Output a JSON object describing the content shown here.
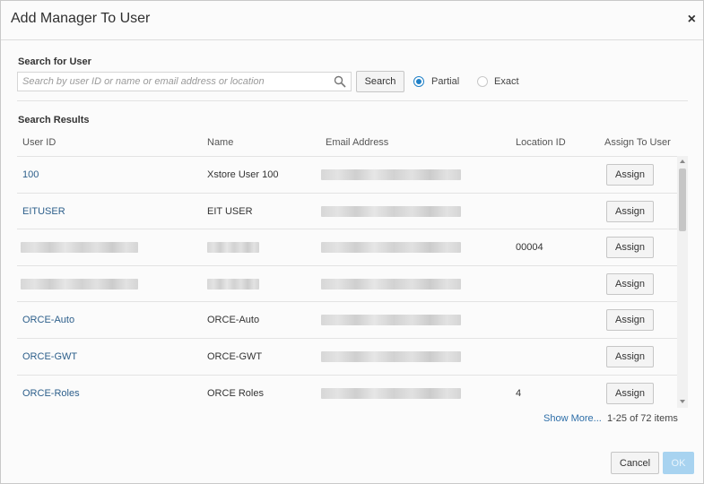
{
  "dialog": {
    "title": "Add Manager To User",
    "close_icon": "×"
  },
  "search": {
    "heading": "Search for User",
    "placeholder": "Search by user ID or name or email address or location",
    "value": "",
    "button_label": "Search",
    "modes": [
      {
        "label": "Partial",
        "selected": true
      },
      {
        "label": "Exact",
        "selected": false
      }
    ]
  },
  "results": {
    "heading": "Search Results",
    "columns": [
      "User ID",
      "Name",
      "Email Address",
      "Location ID",
      "Assign To User"
    ],
    "rows": [
      {
        "user_id": "100",
        "name": "Xstore User 100",
        "location_id": "",
        "action": "Assign",
        "user_id_redacted": false,
        "name_redacted": false
      },
      {
        "user_id": "EITUSER",
        "name": "EIT USER",
        "location_id": "",
        "action": "Assign",
        "user_id_redacted": false,
        "name_redacted": false
      },
      {
        "user_id": "",
        "name": "",
        "location_id": "00004",
        "action": "Assign",
        "user_id_redacted": true,
        "name_redacted": true
      },
      {
        "user_id": "",
        "name": "",
        "location_id": "",
        "action": "Assign",
        "user_id_redacted": true,
        "name_redacted": true
      },
      {
        "user_id": "ORCE-Auto",
        "name": "ORCE-Auto",
        "location_id": "",
        "action": "Assign",
        "user_id_redacted": false,
        "name_redacted": false
      },
      {
        "user_id": "ORCE-GWT",
        "name": "ORCE-GWT",
        "location_id": "",
        "action": "Assign",
        "user_id_redacted": false,
        "name_redacted": false
      },
      {
        "user_id": "ORCE-Roles",
        "name": "ORCE Roles",
        "location_id": "4",
        "action": "Assign",
        "user_id_redacted": false,
        "name_redacted": false
      }
    ],
    "show_more": "Show More...",
    "count": "1-25 of 72 items"
  },
  "footer": {
    "cancel_label": "Cancel",
    "ok_label": "OK"
  },
  "colors": {
    "accent": "#1f80c7",
    "link": "#2d6ea8",
    "ok_disabled": "#a8d3f0"
  }
}
